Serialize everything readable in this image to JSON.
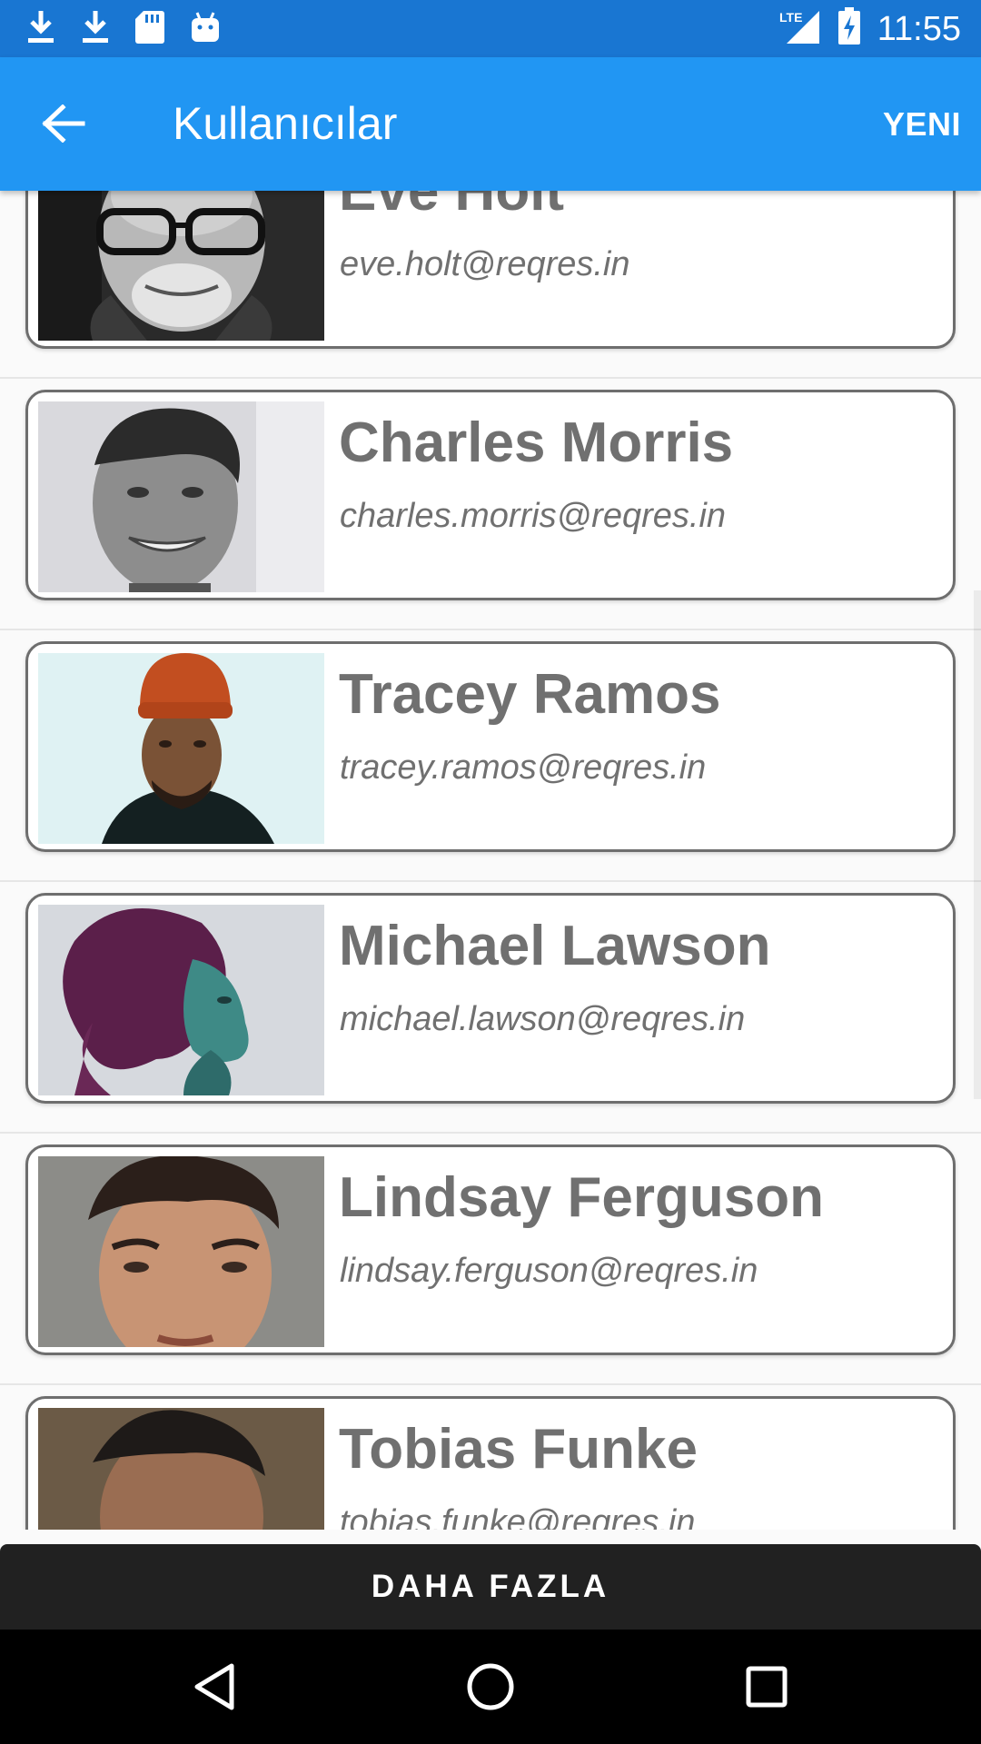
{
  "status_bar": {
    "time": "11:55",
    "left_icons": [
      "download-icon",
      "download-icon",
      "sd-card-icon",
      "android-icon"
    ],
    "right_icons": [
      "lte-signal-icon",
      "battery-charging-icon"
    ],
    "lte_label": "LTE"
  },
  "app_bar": {
    "title": "Kullanıcılar",
    "back_icon": "arrow-back-icon",
    "new_label": "YENI",
    "background": "#2196f3"
  },
  "users": [
    {
      "name": "Eve Holt",
      "email": "eve.holt@reqres.in",
      "photo": "bearded-man-glasses-bw"
    },
    {
      "name": "Charles Morris",
      "email": "charles.morris@reqres.in",
      "photo": "smiling-man-bw"
    },
    {
      "name": "Tracey Ramos",
      "email": "tracey.ramos@reqres.in",
      "photo": "man-orange-beanie"
    },
    {
      "name": "Michael Lawson",
      "email": "michael.lawson@reqres.in",
      "photo": "woman-profile-purple-teal"
    },
    {
      "name": "Lindsay Ferguson",
      "email": "lindsay.ferguson@reqres.in",
      "photo": "young-man-closeup"
    },
    {
      "name": "Tobias Funke",
      "email": "tobias.funke@reqres.in",
      "photo": "man-partial"
    }
  ],
  "more_button": {
    "label": "DAHA FAZLA"
  },
  "nav_bar": {
    "icons": [
      "back-triangle-icon",
      "home-circle-icon",
      "recents-square-icon"
    ]
  }
}
